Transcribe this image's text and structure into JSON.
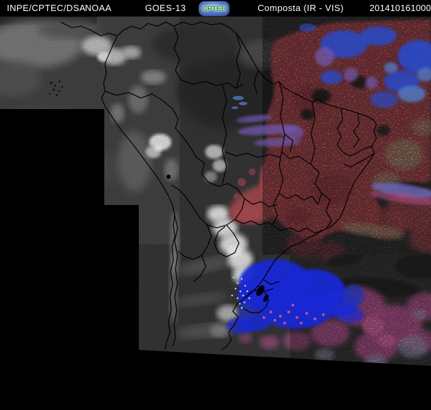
{
  "header": {
    "agency": "INPE/CPTEC/DSA",
    "noaa": "NOAA",
    "satellite": "GOES-13",
    "logo_text": "CPTEC",
    "product": "Composta (IR - VIS)",
    "timestamp": "201410161000"
  },
  "palette": {
    "background": "#000000",
    "header_text": "#ffffff",
    "logo_green": "#2f9e33",
    "vis_gray_base": "#3a3a3a",
    "cloud_white": "#e8e8e8",
    "ir_red": "#b85158",
    "ir_dark_red": "#97404b",
    "ir_magenta": "#c25a9a",
    "ir_blue": "#1e2ef2",
    "ir_sky_blue": "#2e55e6",
    "ir_purple": "#8066c8",
    "ir_tan": "#b2957c",
    "border_line": "#000000"
  }
}
